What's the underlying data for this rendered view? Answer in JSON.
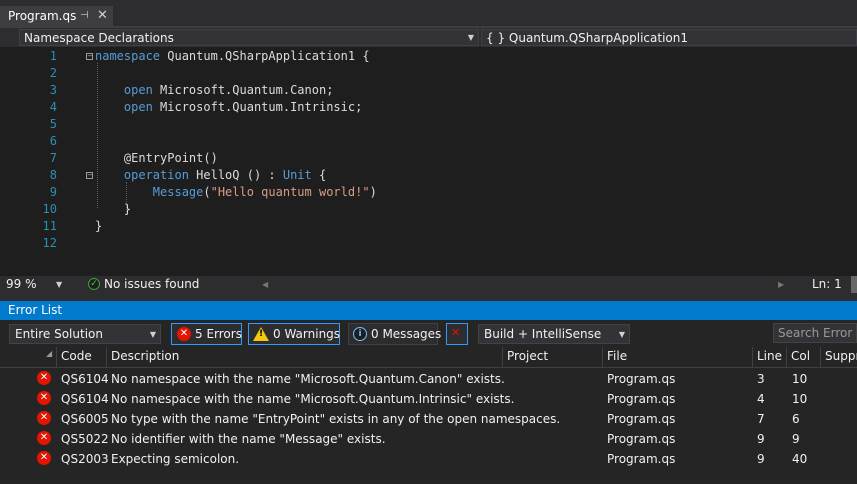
{
  "tab": {
    "title": "Program.qs",
    "pin_icon": "pin-icon",
    "close_icon": "close-icon"
  },
  "navbar": {
    "left_combo": "Namespace Declarations",
    "right_combo": "{ } Quantum.QSharpApplication1"
  },
  "editor": {
    "lines": [
      {
        "n": "1",
        "segments": [
          {
            "t": "namespace",
            "c": "kw"
          },
          {
            "t": " Quantum.QSharpApplication1 {",
            "c": "plain"
          }
        ]
      },
      {
        "n": "2",
        "segments": []
      },
      {
        "n": "3",
        "segments": [
          {
            "t": "    open",
            "c": "kw"
          },
          {
            "t": " Microsoft.Quantum.Canon;",
            "c": "plain"
          }
        ]
      },
      {
        "n": "4",
        "segments": [
          {
            "t": "    open",
            "c": "kw"
          },
          {
            "t": " Microsoft.Quantum.Intrinsic;",
            "c": "plain"
          }
        ]
      },
      {
        "n": "5",
        "segments": []
      },
      {
        "n": "6",
        "segments": []
      },
      {
        "n": "7",
        "segments": [
          {
            "t": "    @EntryPoint()",
            "c": "plain"
          }
        ]
      },
      {
        "n": "8",
        "segments": [
          {
            "t": "    operation",
            "c": "kw"
          },
          {
            "t": " HelloQ () : ",
            "c": "plain"
          },
          {
            "t": "Unit",
            "c": "kw"
          },
          {
            "t": " {",
            "c": "plain"
          }
        ]
      },
      {
        "n": "9",
        "segments": [
          {
            "t": "        Message",
            "c": "fn"
          },
          {
            "t": "(",
            "c": "plain"
          },
          {
            "t": "\"Hello quantum world!\"",
            "c": "str"
          },
          {
            "t": ")",
            "c": "plain"
          }
        ]
      },
      {
        "n": "10",
        "segments": [
          {
            "t": "    }",
            "c": "plain"
          }
        ]
      },
      {
        "n": "11",
        "segments": [
          {
            "t": "}",
            "c": "plain"
          }
        ]
      },
      {
        "n": "12",
        "segments": []
      }
    ]
  },
  "status": {
    "zoom": "99 %",
    "issues": "No issues found",
    "position": "Ln: 1",
    "col": "C"
  },
  "error_list": {
    "title": "Error List",
    "scope": "Entire Solution",
    "errors_btn": "5 Errors",
    "warnings_btn": "0 Warnings",
    "messages_btn": "0 Messages",
    "build_combo": "Build + IntelliSense",
    "search_placeholder": "Search Error Lis",
    "columns": {
      "code": "Code",
      "description": "Description",
      "project": "Project",
      "file": "File",
      "line": "Line",
      "col": "Col",
      "suppression": "Suppr"
    },
    "rows": [
      {
        "code": "QS6104",
        "description": "No namespace with the name \"Microsoft.Quantum.Canon\" exists.",
        "project": "",
        "file": "Program.qs",
        "line": "3",
        "col": "10"
      },
      {
        "code": "QS6104",
        "description": "No namespace with the name \"Microsoft.Quantum.Intrinsic\" exists.",
        "project": "",
        "file": "Program.qs",
        "line": "4",
        "col": "10"
      },
      {
        "code": "QS6005",
        "description": "No type with the name \"EntryPoint\" exists in any of the open namespaces.",
        "project": "",
        "file": "Program.qs",
        "line": "7",
        "col": "6"
      },
      {
        "code": "QS5022",
        "description": "No identifier with the name \"Message\" exists.",
        "project": "",
        "file": "Program.qs",
        "line": "9",
        "col": "9"
      },
      {
        "code": "QS2003",
        "description": "Expecting semicolon.",
        "project": "",
        "file": "Program.qs",
        "line": "9",
        "col": "40"
      }
    ]
  },
  "colors": {
    "accent": "#007acc",
    "error": "#e51400",
    "warning": "#f2c811",
    "keyword": "#569cd6",
    "string": "#d69d85",
    "line_number": "#2b91af"
  }
}
